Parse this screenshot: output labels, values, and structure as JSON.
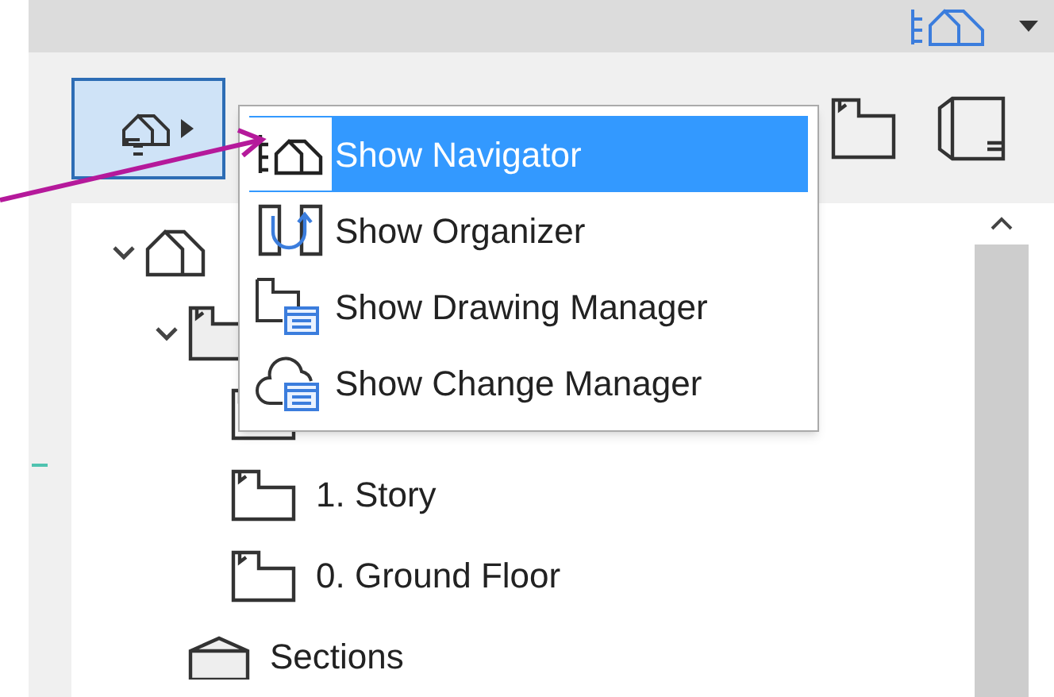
{
  "toolbar": {
    "buttons": [
      {
        "kind": "navigator",
        "selected": true,
        "expanded": true
      },
      {
        "kind": "layouts",
        "selected": false
      },
      {
        "kind": "publisher",
        "selected": false
      }
    ]
  },
  "menu": [
    {
      "kind": "navigator",
      "label": "Show Navigator",
      "selected": true
    },
    {
      "kind": "organizer",
      "label": "Show Organizer",
      "selected": false
    },
    {
      "kind": "drawing-manager",
      "label": "Show Drawing Manager",
      "selected": false
    },
    {
      "kind": "change-manager",
      "label": "Show Change Manager",
      "selected": false
    }
  ],
  "tree": [
    {
      "kind": "project",
      "expanded": true,
      "children": [
        {
          "kind": "floor-plans",
          "expanded": true,
          "children": [
            {
              "kind": "story"
            },
            {
              "kind": "story",
              "label": "1. Story"
            },
            {
              "kind": "story",
              "label": "0. Ground Floor"
            }
          ]
        },
        {
          "kind": "sections",
          "label": "Sections"
        }
      ]
    }
  ]
}
